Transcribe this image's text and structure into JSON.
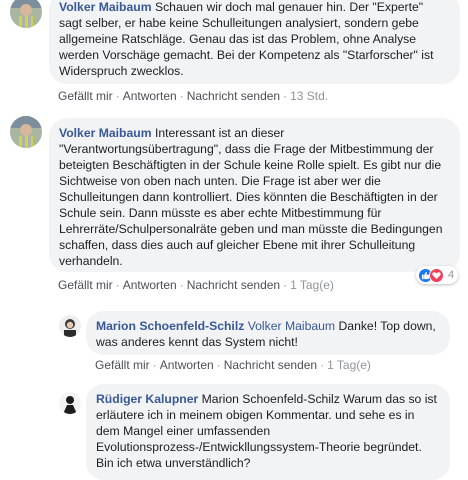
{
  "comments": [
    {
      "author": "Volker Maibaum",
      "text": "Schauen wir doch mal genauer hin. Der \"Experte\" sagt selber, er habe keine Schulleitungen analysiert, sondern gebe allgemeine Ratschläge. Genau das ist das Problem, ohne Analyse werden Vorschäge gemacht. Bei der Kompetenz als \"Starforscher\" ist Widerspruch zwecklos.",
      "actions": {
        "like": "Gefällt mir",
        "reply": "Antworten",
        "message": "Nachricht senden",
        "time": "13 Std."
      }
    },
    {
      "author": "Volker Maibaum",
      "text": "Interessant ist an dieser \"Verantwortungsübertragung\", dass die Frage der Mitbestimmung der beteigten Beschäftigten in der Schule keine Rolle spielt. Es gibt nur die Sichtweise von oben nach unten. Die Frage ist aber wer die Schulleitungen dann kontrolliert. Dies könnten die Beschäftigten in der Schule sein. Dann müsste es aber echte Mitbestimmung für Lehrerräte/Schulpersonalräte geben und man müsste die Bedingungen schaffen, dass dies auch auf gleicher Ebene mit ihrer Schulleitung verhandeln.",
      "reactions": {
        "count": "4",
        "icons": [
          "like-icon",
          "love-icon"
        ],
        "like_color": "#1877f2",
        "love_color": "#f33e58"
      },
      "actions": {
        "like": "Gefällt mir",
        "reply": "Antworten",
        "message": "Nachricht senden",
        "time": "1 Tag(e)"
      }
    },
    {
      "author": "Marion Schoenfeld-Schilz",
      "mention": "Volker Maibaum",
      "text": "Danke! Top down, was anderes kennt das System nicht!",
      "actions": {
        "like": "Gefällt mir",
        "reply": "Antworten",
        "message": "Nachricht senden",
        "time": "1 Tag(e)"
      }
    },
    {
      "author": "Rüdiger Kalupner",
      "text": "Marion Schoenfeld-Schilz Warum das so ist erläutere ich in meinem obigen Kommentar. und sehe es in dem Mangel einer umfassenden Evolutionsprozess-/Entwickllungssystem-Theorie begründet. Bin ich etwa unverständlich?"
    }
  ],
  "colors": {
    "author_link": "#385898",
    "bubble_bg": "#f2f3f5",
    "meta_text": "#606770"
  }
}
